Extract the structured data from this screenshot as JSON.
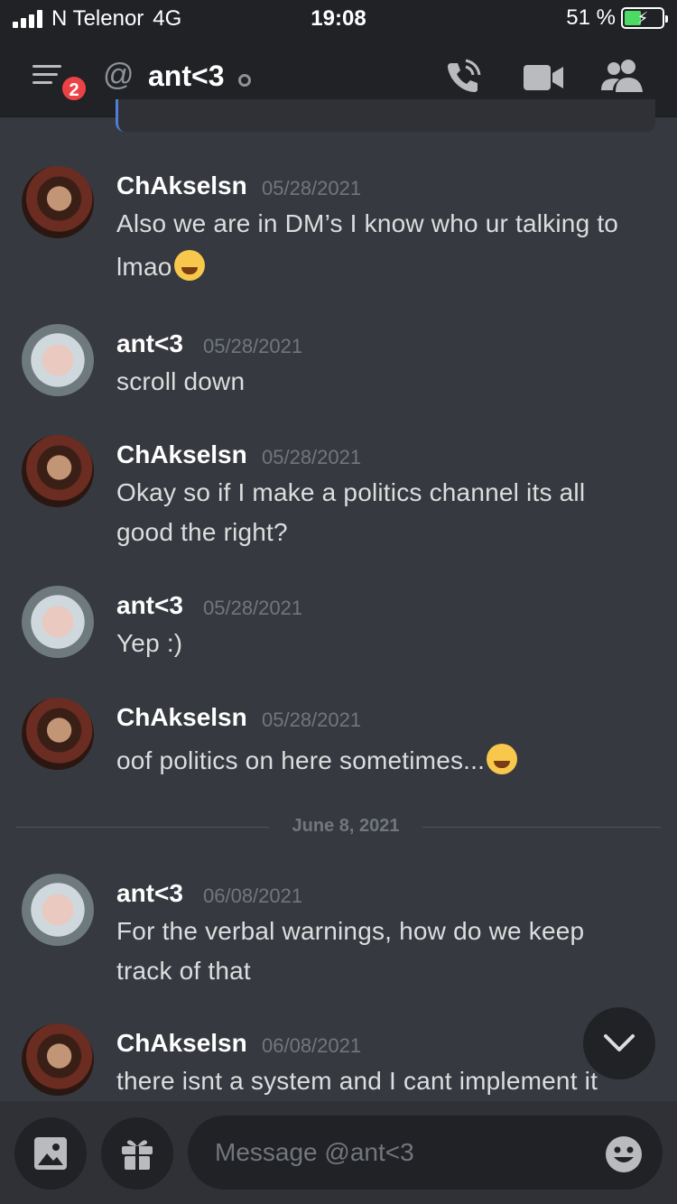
{
  "status_bar": {
    "carrier": "N Telenor",
    "network": "4G",
    "time": "19:08",
    "battery_percent": "51 %",
    "battery_level": 0.51
  },
  "header": {
    "notification_count": "2",
    "at_symbol": "@",
    "title": "ant<3",
    "icons": [
      "menu-icon",
      "at-icon",
      "call-icon",
      "video-icon",
      "members-icon"
    ]
  },
  "messages": [
    {
      "author": "ChAkselsn",
      "timestamp": "05/28/2021",
      "lines": [
        "Also we are in DM’s I know who ur talking to",
        "lmao"
      ],
      "emoji": "joy"
    },
    {
      "author": "ant<3",
      "timestamp": "05/28/2021",
      "lines": [
        "scroll down"
      ]
    },
    {
      "author": "ChAkselsn",
      "timestamp": "05/28/2021",
      "lines": [
        "Okay so if I make a politics channel its all",
        "good the right?"
      ]
    },
    {
      "author": "ant<3",
      "timestamp": "05/28/2021",
      "lines": [
        "Yep :)"
      ]
    },
    {
      "author": "ChAkselsn",
      "timestamp": "05/28/2021",
      "lines": [
        "oof politics on here sometimes..."
      ],
      "emoji": "joy"
    },
    {
      "author": "ant<3",
      "timestamp": "06/08/2021",
      "lines": [
        "For the verbal warnings, how do we keep",
        "track of that"
      ]
    },
    {
      "author": "ChAkselsn",
      "timestamp": "06/08/2021",
      "lines": [
        "there isnt a system and I cant implement it"
      ]
    }
  ],
  "divider": {
    "label": "June 8, 2021"
  },
  "composer": {
    "placeholder": "Message @ant<3",
    "icons": [
      "image-icon",
      "gift-icon",
      "emoji-icon"
    ]
  },
  "colors": {
    "background": "#36393f",
    "header": "#202225",
    "badge": "#ed4245",
    "battery": "#4cd964"
  }
}
